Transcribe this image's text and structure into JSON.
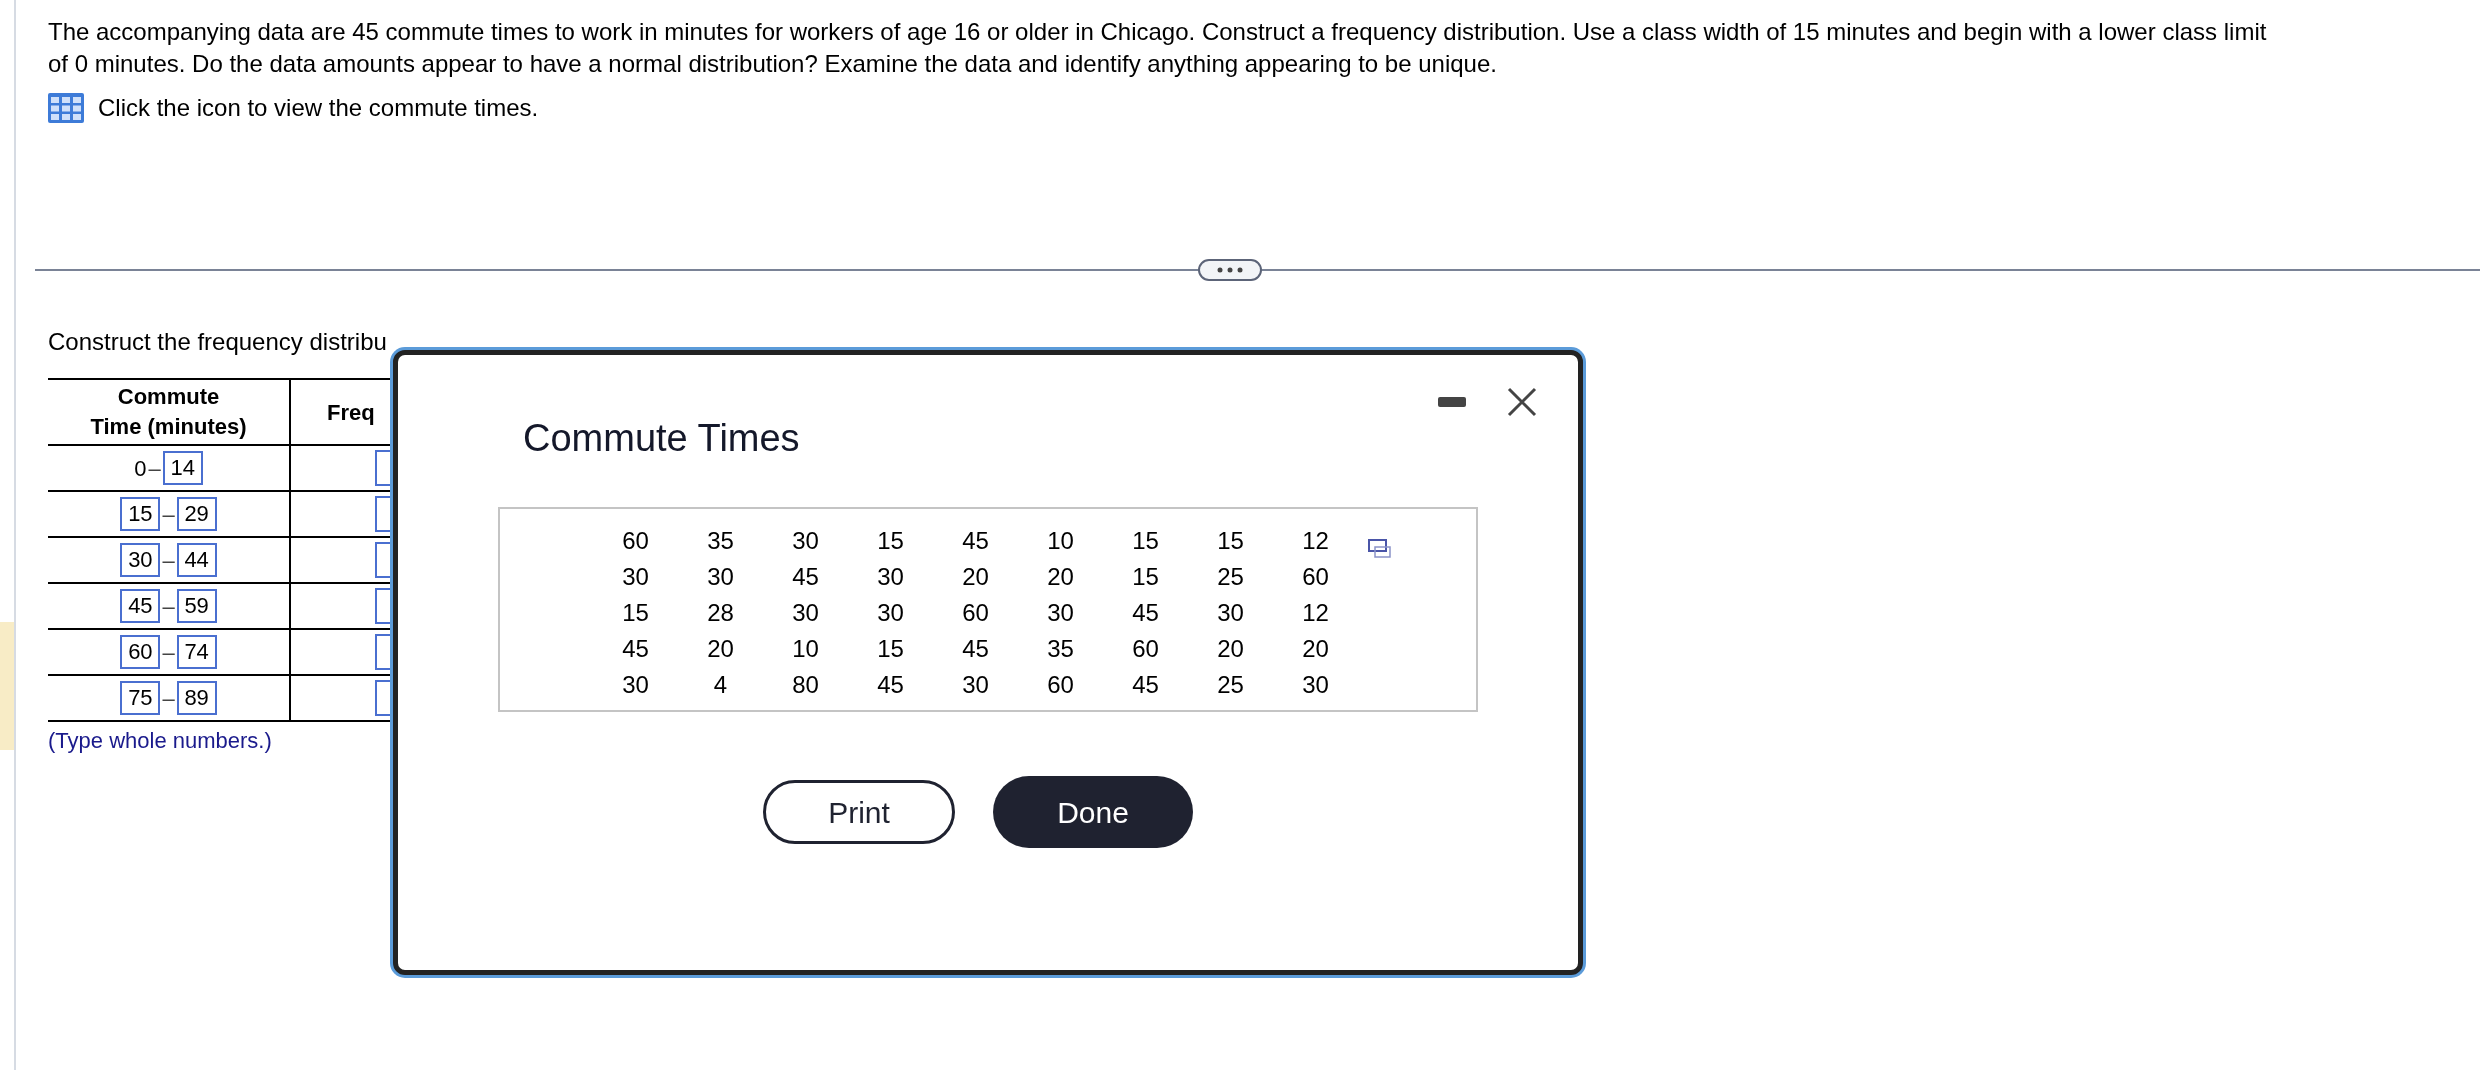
{
  "question": {
    "lines": [
      "The accompanying data are 45 commute times to work in minutes for workers of age 16 or older in Chicago. Construct a frequency distribution. Use a class width of 15 minutes and begin with a lower class limit",
      "of 0 minutes. Do the data amounts appear to have a normal distribution? Examine the data and identify anything appearing to be unique."
    ],
    "data_link": "Click the icon to view the commute times."
  },
  "section_prompt": "Construct the frequency distribu",
  "freq_table": {
    "heading_lines": [
      "Commute",
      "Time (minutes)"
    ],
    "column_2": "Freq",
    "rows": [
      {
        "lower": {
          "kind": "text",
          "value": "0"
        },
        "dash": "–",
        "upper": {
          "kind": "field",
          "value": "14"
        }
      },
      {
        "lower": {
          "kind": "field",
          "value": "15"
        },
        "dash": "–",
        "upper": {
          "kind": "field",
          "value": "29"
        }
      },
      {
        "lower": {
          "kind": "field",
          "value": "30"
        },
        "dash": "–",
        "upper": {
          "kind": "field",
          "value": "44"
        }
      },
      {
        "lower": {
          "kind": "field",
          "value": "45"
        },
        "dash": "–",
        "upper": {
          "kind": "field",
          "value": "59"
        }
      },
      {
        "lower": {
          "kind": "field",
          "value": "60"
        },
        "dash": "–",
        "upper": {
          "kind": "field",
          "value": "74"
        }
      },
      {
        "lower": {
          "kind": "field",
          "value": "75"
        },
        "dash": "–",
        "upper": {
          "kind": "field",
          "value": "89"
        }
      }
    ],
    "note": "(Type whole numbers.)"
  },
  "dialog": {
    "title": "Commute Times",
    "data": [
      [
        "60",
        "35",
        "30",
        "15",
        "45",
        "10",
        "15",
        "15",
        "12"
      ],
      [
        "30",
        "30",
        "45",
        "30",
        "20",
        "20",
        "15",
        "25",
        "60"
      ],
      [
        "15",
        "28",
        "30",
        "30",
        "60",
        "30",
        "45",
        "30",
        "12"
      ],
      [
        "45",
        "20",
        "10",
        "15",
        "45",
        "35",
        "60",
        "20",
        "20"
      ],
      [
        "30",
        "4",
        "80",
        "45",
        "30",
        "60",
        "45",
        "25",
        "30"
      ]
    ],
    "buttons": [
      {
        "label": "Print",
        "kind": "outline"
      },
      {
        "label": "Done",
        "kind": "primary"
      }
    ]
  }
}
